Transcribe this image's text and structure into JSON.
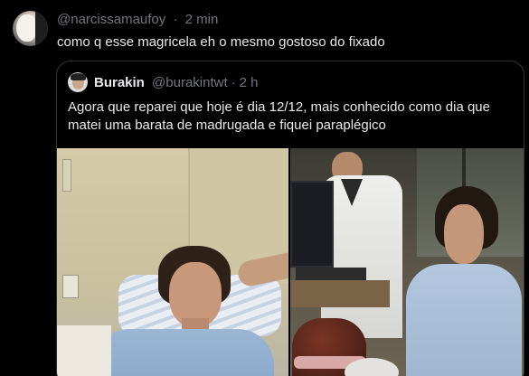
{
  "post": {
    "username": "@narcissamaufoy",
    "separator": "·",
    "time": "2 min",
    "text": "como q esse magricela eh o mesmo gostoso do fixado"
  },
  "quote": {
    "display_name": "Burakin",
    "handle": "@burakintwt",
    "separator": "·",
    "time": "2 h",
    "text": "Agora que reparei que hoje é dia 12/12, mais conhecido como dia que matei uma barata de madrugada e fiquei paraplégico"
  }
}
